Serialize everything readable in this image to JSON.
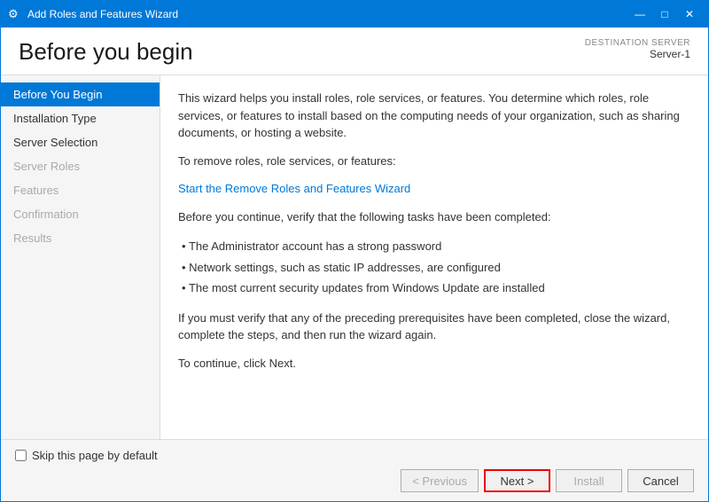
{
  "window": {
    "title": "Add Roles and Features Wizard",
    "icon": "⚙"
  },
  "title_controls": {
    "minimize": "—",
    "maximize": "□",
    "close": "✕"
  },
  "header": {
    "title": "Before you begin",
    "destination_label": "DESTINATION SERVER",
    "destination_value": "Server-1"
  },
  "sidebar": {
    "items": [
      {
        "label": "Before You Begin",
        "state": "active"
      },
      {
        "label": "Installation Type",
        "state": "normal"
      },
      {
        "label": "Server Selection",
        "state": "normal"
      },
      {
        "label": "Server Roles",
        "state": "disabled"
      },
      {
        "label": "Features",
        "state": "disabled"
      },
      {
        "label": "Confirmation",
        "state": "disabled"
      },
      {
        "label": "Results",
        "state": "disabled"
      }
    ]
  },
  "content": {
    "paragraph1": "This wizard helps you install roles, role services, or features. You determine which roles, role services, or features to install based on the computing needs of your organization, such as sharing documents, or hosting a website.",
    "paragraph2": "To remove roles, role services, or features:",
    "link_text": "Start the Remove Roles and Features Wizard",
    "paragraph3": "Before you continue, verify that the following tasks have been completed:",
    "bullets": [
      "The Administrator account has a strong password",
      "Network settings, such as static IP addresses, are configured",
      "The most current security updates from Windows Update are installed"
    ],
    "paragraph4": "If you must verify that any of the preceding prerequisites have been completed, close the wizard, complete the steps, and then run the wizard again.",
    "paragraph5": "To continue, click Next."
  },
  "footer": {
    "checkbox_label": "Skip this page by default",
    "buttons": {
      "previous": "< Previous",
      "next": "Next >",
      "install": "Install",
      "cancel": "Cancel"
    }
  }
}
